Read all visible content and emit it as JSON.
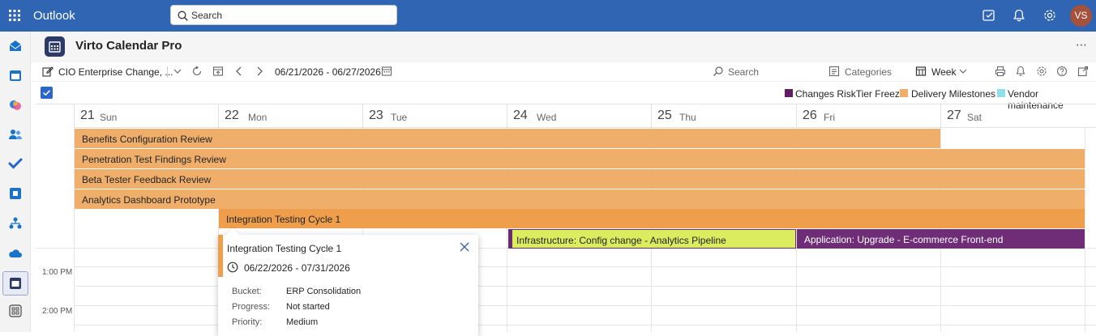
{
  "topbar": {
    "app_name": "Outlook",
    "search_placeholder": "Search",
    "avatar_initials": "VS",
    "color": "#2f65b3"
  },
  "leftrail": {
    "items": [
      "mail-icon",
      "calendar-icon",
      "copilot-icon",
      "people-icon",
      "todo-icon",
      "bookings-icon",
      "org-explorer-icon",
      "onedrive-icon",
      "virto-calendar-icon",
      "more-apps-icon"
    ]
  },
  "app": {
    "title": "Virto Calendar Pro",
    "more": "⋯"
  },
  "toolbar": {
    "calendar_name": "CIO Enterprise Change, ...",
    "date_range": "06/21/2026 - 06/27/2026",
    "search_label": "Search",
    "categories_label": "Categories",
    "view_label": "Week"
  },
  "legend": [
    {
      "label": "Changes RiskTier Freeze",
      "color": "#5c1f61"
    },
    {
      "label": "Delivery Milestones",
      "color": "#f0ae6b"
    },
    {
      "label": "Vendor maintenance",
      "color": "#8fe0e8"
    }
  ],
  "days": [
    {
      "num": "21",
      "name": "Sun"
    },
    {
      "num": "22",
      "name": "Mon"
    },
    {
      "num": "23",
      "name": "Tue"
    },
    {
      "num": "24",
      "name": "Wed"
    },
    {
      "num": "25",
      "name": "Thu"
    },
    {
      "num": "26",
      "name": "Fri"
    },
    {
      "num": "27",
      "name": "Sat"
    }
  ],
  "events": [
    {
      "title": "Benefits Configuration Review"
    },
    {
      "title": "Penetration Test Findings Review"
    },
    {
      "title": "Beta Tester Feedback Review"
    },
    {
      "title": "Analytics Dashboard Prototype"
    },
    {
      "title": "Integration Testing Cycle 1"
    },
    {
      "title": "Infrastructure: Config change - Analytics Pipeline"
    },
    {
      "title": "Application: Upgrade - E-commerce Front-end"
    }
  ],
  "times": [
    "1:00 PM",
    "2:00 PM"
  ],
  "popup": {
    "title": "Integration Testing Cycle 1",
    "dates": "06/22/2026 - 07/31/2026",
    "rows": [
      {
        "label": "Bucket:",
        "value": "ERP Consolidation"
      },
      {
        "label": "Progress:",
        "value": "Not started"
      },
      {
        "label": "Priority:",
        "value": "Medium"
      }
    ]
  }
}
